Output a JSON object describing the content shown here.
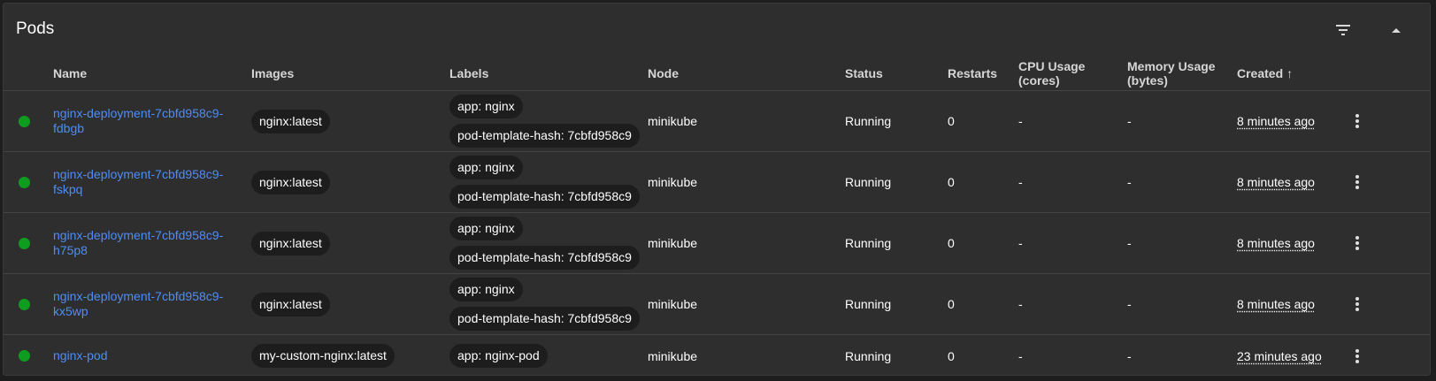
{
  "panel": {
    "title": "Pods",
    "filter_icon": "filter-icon",
    "collapse_icon": "chevron-up-icon"
  },
  "columns": {
    "name": "Name",
    "images": "Images",
    "labels": "Labels",
    "node": "Node",
    "status": "Status",
    "restarts": "Restarts",
    "cpu": "CPU Usage (cores)",
    "memory_line1": "Memory Usage",
    "memory_line2": "(bytes)",
    "created": "Created",
    "created_sort": "↑"
  },
  "colors": {
    "status_running": "#0f9d1f",
    "link": "#4d8df6"
  },
  "pods": [
    {
      "name_line1": "nginx-deployment-7cbfd958c9-",
      "name_line2": "fdbgb",
      "image": "nginx:latest",
      "labels": [
        "app: nginx",
        "pod-template-hash: 7cbfd958c9"
      ],
      "node": "minikube",
      "status": "Running",
      "restarts": "0",
      "cpu": "-",
      "memory": "-",
      "created": "8 minutes ago"
    },
    {
      "name_line1": "nginx-deployment-7cbfd958c9-",
      "name_line2": "fskpq",
      "image": "nginx:latest",
      "labels": [
        "app: nginx",
        "pod-template-hash: 7cbfd958c9"
      ],
      "node": "minikube",
      "status": "Running",
      "restarts": "0",
      "cpu": "-",
      "memory": "-",
      "created": "8 minutes ago"
    },
    {
      "name_line1": "nginx-deployment-7cbfd958c9-",
      "name_line2": "h75p8",
      "image": "nginx:latest",
      "labels": [
        "app: nginx",
        "pod-template-hash: 7cbfd958c9"
      ],
      "node": "minikube",
      "status": "Running",
      "restarts": "0",
      "cpu": "-",
      "memory": "-",
      "created": "8 minutes ago"
    },
    {
      "name_line1": "nginx-deployment-7cbfd958c9-",
      "name_line2": "kx5wp",
      "image": "nginx:latest",
      "labels": [
        "app: nginx",
        "pod-template-hash: 7cbfd958c9"
      ],
      "node": "minikube",
      "status": "Running",
      "restarts": "0",
      "cpu": "-",
      "memory": "-",
      "created": "8 minutes ago"
    },
    {
      "name_line1": "nginx-pod",
      "name_line2": "",
      "image": "my-custom-nginx:latest",
      "labels": [
        "app: nginx-pod"
      ],
      "node": "minikube",
      "status": "Running",
      "restarts": "0",
      "cpu": "-",
      "memory": "-",
      "created": "23 minutes ago"
    }
  ]
}
